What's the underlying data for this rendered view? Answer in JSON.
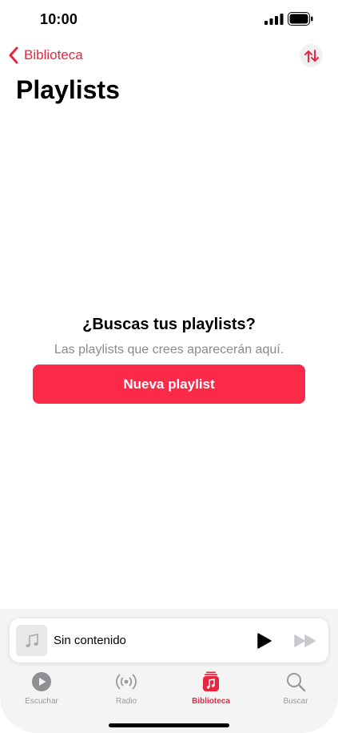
{
  "status_bar": {
    "time": "10:00"
  },
  "nav": {
    "back_label": "Biblioteca"
  },
  "page": {
    "title": "Playlists"
  },
  "empty_state": {
    "title": "¿Buscas tus playlists?",
    "subtitle": "Las playlists que crees aparecerán aquí.",
    "button_label": "Nueva playlist"
  },
  "mini_player": {
    "title": "Sin contenido"
  },
  "tabs": [
    {
      "label": "Escuchar",
      "icon": "play-circle-icon",
      "active": false
    },
    {
      "label": "Radio",
      "icon": "radio-waves-icon",
      "active": false
    },
    {
      "label": "Biblioteca",
      "icon": "library-music-icon",
      "active": true
    },
    {
      "label": "Buscar",
      "icon": "search-icon",
      "active": false
    }
  ],
  "colors": {
    "accent": "#e8263f",
    "button": "#fa2a48",
    "inactive": "#9a9a9e"
  }
}
